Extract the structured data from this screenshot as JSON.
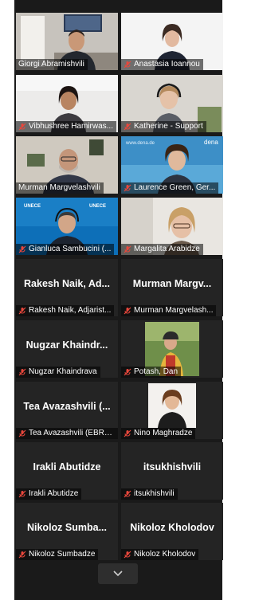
{
  "participants": [
    {
      "name": "Giorgi Abramishvili",
      "muted": false,
      "video": true,
      "speaking": true
    },
    {
      "name": "Anastasia Ioannou",
      "muted": true,
      "video": true
    },
    {
      "name": "Vibhushree Hamirwas...",
      "muted": true,
      "video": true
    },
    {
      "name": "Katherine - Support",
      "muted": true,
      "video": true
    },
    {
      "name": "Murman Margvelashvili",
      "muted": false,
      "video": true
    },
    {
      "name": "Laurence Green, Ger...",
      "muted": true,
      "video": true
    },
    {
      "name": "Gianluca Sambucini (...",
      "muted": true,
      "video": true
    },
    {
      "name": "Margalita Arabidze",
      "muted": true,
      "video": true
    },
    {
      "name": "Rakesh Naik, Adjarist...",
      "display": "Rakesh Naik, Ad...",
      "muted": true,
      "video": false
    },
    {
      "name": "Murman Margvelash...",
      "display": "Murman Margv...",
      "muted": true,
      "video": false
    },
    {
      "name": "Nugzar Khaindrava",
      "display": "Nugzar Khaindr...",
      "muted": true,
      "video": false
    },
    {
      "name": "Potash, Dan",
      "muted": true,
      "video": true
    },
    {
      "name": "Tea Avazashvili (EBRD...",
      "display": "Tea Avazashvili (...",
      "muted": true,
      "video": false
    },
    {
      "name": "Nino Maghradze",
      "muted": true,
      "video": true
    },
    {
      "name": "Irakli Abutidze",
      "display": "Irakli Abutidze",
      "muted": true,
      "video": false
    },
    {
      "name": "itsukhishvili",
      "display": "itsukhishvili",
      "muted": true,
      "video": false
    },
    {
      "name": "Nikoloz Sumbadze",
      "display": "Nikoloz Sumba...",
      "muted": true,
      "video": false
    },
    {
      "name": "Nikoloz Kholodov",
      "display": "Nikoloz Kholodov",
      "muted": true,
      "video": false
    }
  ],
  "logos": {
    "unece": "UNECE",
    "dena": "dena",
    "dena_url": "www.dena.de"
  },
  "colors": {
    "background": "#1a1a1a",
    "tile": "#242424",
    "active_speaker_border": "#d9e23b",
    "mute_icon": "#e8473c"
  },
  "icons": {
    "mute": "muted-microphone-icon",
    "scroll": "chevron-down-icon"
  }
}
